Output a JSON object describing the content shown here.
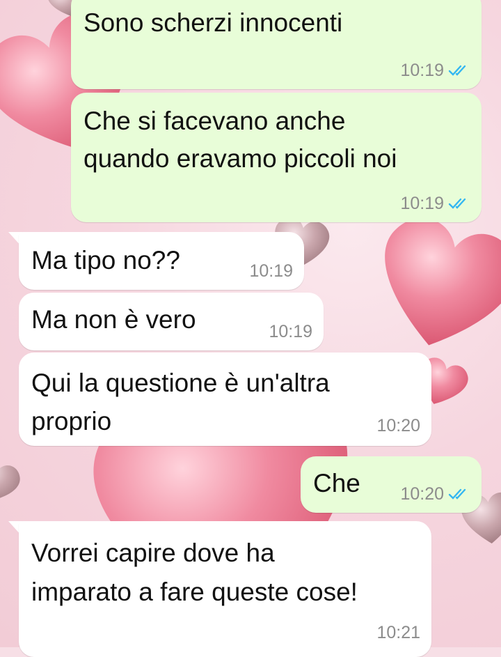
{
  "colors": {
    "outgoing_bubble": "#e8fdd8",
    "incoming_bubble": "#ffffff",
    "read_ticks": "#34b7f1",
    "timestamp": "#8c8c8c",
    "wallpaper": "#f7dfe6"
  },
  "wallpaper": {
    "description": "pink-hearts-wallpaper"
  },
  "messages": [
    {
      "direction": "outgoing",
      "lines": [
        "Sono scherzi innocenti"
      ],
      "time": "10:19",
      "status_icon": "double-check-read-icon"
    },
    {
      "direction": "outgoing",
      "lines": [
        "Che si facevano anche",
        "quando eravamo piccoli noi"
      ],
      "time": "10:19",
      "status_icon": "double-check-read-icon"
    },
    {
      "direction": "incoming",
      "lines": [
        "Ma tipo no??"
      ],
      "time": "10:19"
    },
    {
      "direction": "incoming",
      "lines": [
        "Ma non è vero"
      ],
      "time": "10:19"
    },
    {
      "direction": "incoming",
      "lines": [
        "Qui la questione è un'altra",
        "proprio"
      ],
      "time": "10:20"
    },
    {
      "direction": "outgoing",
      "lines": [
        "Che"
      ],
      "time": "10:20",
      "status_icon": "double-check-read-icon"
    },
    {
      "direction": "incoming",
      "lines": [
        "Vorrei capire dove ha",
        "imparato a fare queste cose!"
      ],
      "time": "10:21"
    }
  ]
}
